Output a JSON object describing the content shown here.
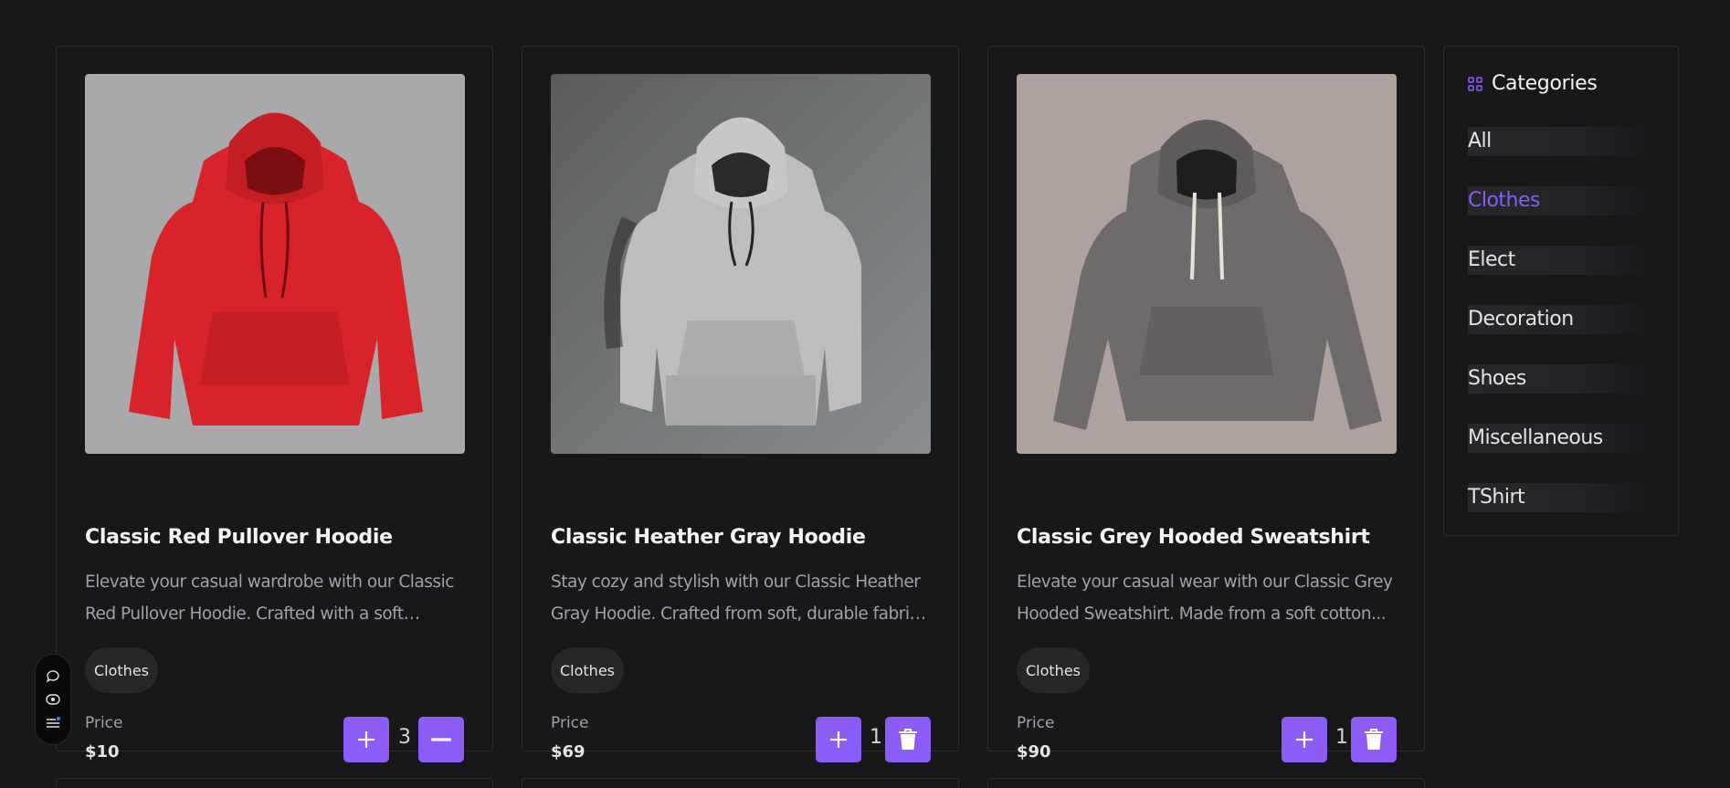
{
  "products": [
    {
      "title": "Classic Red Pullover Hoodie",
      "description": "Elevate your casual wardrobe with our Classic Red Pullover Hoodie. Crafted with a soft cotton...",
      "category": "Clothes",
      "price_label": "Price",
      "price": "$10",
      "quantity": "3",
      "color": "#d8232a",
      "bg": "#a9a9ab",
      "secondary_action": "minus-icon"
    },
    {
      "title": "Classic Heather Gray Hoodie",
      "description": "Stay cozy and stylish with our Classic Heather Gray Hoodie. Crafted from soft, durable fabric, it...",
      "category": "Clothes",
      "price_label": "Price",
      "price": "$69",
      "quantity": "1",
      "color": "#bdbdbd",
      "bg": "#6b6d6e",
      "secondary_action": "trash-icon"
    },
    {
      "title": "Classic Grey Hooded Sweatshirt",
      "description": "Elevate your casual wear with our Classic Grey Hooded Sweatshirt. Made from a soft cotton...",
      "category": "Clothes",
      "price_label": "Price",
      "price": "$90",
      "quantity": "1",
      "color": "#6f6b6b",
      "bg": "#ada29e",
      "secondary_action": "trash-icon"
    }
  ],
  "sidebar": {
    "title": "Categories",
    "icon": "grid-icon",
    "items": [
      {
        "label": "All",
        "active": false
      },
      {
        "label": "Clothes",
        "active": true
      },
      {
        "label": "Elect",
        "active": false
      },
      {
        "label": "Decoration",
        "active": false
      },
      {
        "label": "Shoes",
        "active": false
      },
      {
        "label": "Miscellaneous",
        "active": false
      },
      {
        "label": "TShirt",
        "active": false
      }
    ]
  },
  "floating_toolbar": {
    "icons": [
      "chat-icon",
      "eye-icon",
      "menu-icon"
    ]
  },
  "colors": {
    "accent": "#8b5cf6",
    "background": "#18181b",
    "border": "#2b2b30"
  }
}
